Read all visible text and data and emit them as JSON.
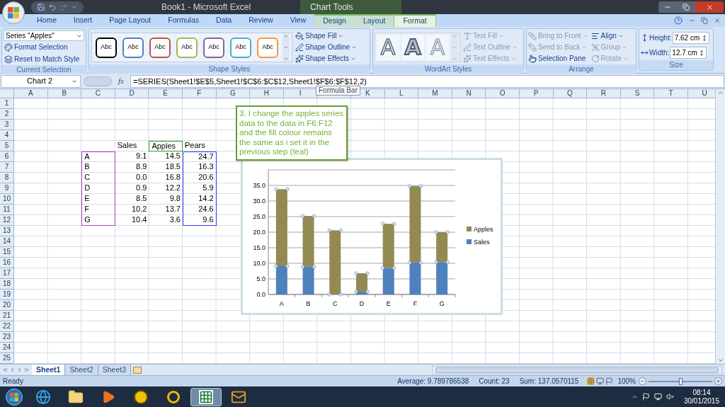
{
  "title_bar": {
    "title": "Book1 - Microsoft Excel",
    "context_group": "Chart Tools"
  },
  "ribbon_tabs": [
    {
      "label": "Home",
      "selected": false,
      "contextual": false
    },
    {
      "label": "Insert",
      "selected": false,
      "contextual": false
    },
    {
      "label": "Page Layout",
      "selected": false,
      "contextual": false
    },
    {
      "label": "Formulas",
      "selected": false,
      "contextual": false
    },
    {
      "label": "Data",
      "selected": false,
      "contextual": false
    },
    {
      "label": "Review",
      "selected": false,
      "contextual": false
    },
    {
      "label": "View",
      "selected": false,
      "contextual": false
    },
    {
      "label": "Design",
      "selected": false,
      "contextual": true
    },
    {
      "label": "Layout",
      "selected": false,
      "contextual": true
    },
    {
      "label": "Format",
      "selected": true,
      "contextual": true
    }
  ],
  "ribbon_groups": [
    {
      "kind": "current_selection",
      "label": "Current Selection",
      "dropdown": "Series \"Apples\"",
      "buttons": [
        {
          "label": "Format Selection",
          "disabled": false,
          "has_menu": false
        },
        {
          "label": "Reset to Match Style",
          "disabled": false,
          "has_menu": false
        }
      ]
    },
    {
      "kind": "shape_styles",
      "label": "Shape Styles",
      "swatches": [
        {
          "text": "Abc",
          "color": "#000000"
        },
        {
          "text": "Abc",
          "color": "#4f81bd"
        },
        {
          "text": "Abc",
          "color": "#c0504d"
        },
        {
          "text": "Abc",
          "color": "#9bbb59"
        },
        {
          "text": "Abc",
          "color": "#8064a2"
        },
        {
          "text": "Abc",
          "color": "#4bacc6"
        },
        {
          "text": "Abc",
          "color": "#f79646"
        }
      ],
      "buttons": [
        {
          "label": "Shape Fill",
          "disabled": false,
          "has_menu": true
        },
        {
          "label": "Shape Outline",
          "disabled": false,
          "has_menu": true
        },
        {
          "label": "Shape Effects",
          "disabled": false,
          "has_menu": true
        }
      ]
    },
    {
      "kind": "wordart",
      "label": "WordArt Styles",
      "samples": [
        {
          "text": "A",
          "kind": "outline"
        },
        {
          "text": "A",
          "kind": "bold"
        },
        {
          "text": "A",
          "kind": "faint"
        }
      ],
      "buttons": [
        {
          "label": "Text Fill",
          "disabled": true,
          "has_menu": true
        },
        {
          "label": "Text Outline",
          "disabled": true,
          "has_menu": true
        },
        {
          "label": "Text Effects",
          "disabled": true,
          "has_menu": true
        }
      ]
    },
    {
      "kind": "arrange",
      "label": "Arrange",
      "buttons": [
        {
          "label": "Bring to Front",
          "disabled": true,
          "has_menu": true
        },
        {
          "label": "Send to Back",
          "disabled": true,
          "has_menu": true
        },
        {
          "label": "Selection Pane",
          "disabled": false,
          "has_menu": false
        },
        {
          "label": "Align",
          "disabled": false,
          "has_menu": true
        },
        {
          "label": "Group",
          "disabled": true,
          "has_menu": true
        },
        {
          "label": "Rotate",
          "disabled": true,
          "has_menu": true
        }
      ]
    },
    {
      "kind": "size",
      "label": "Size",
      "fields": [
        {
          "label": "Height:",
          "value": "7.62 cm"
        },
        {
          "label": "Width:",
          "value": "12.7 cm"
        }
      ]
    }
  ],
  "formula_bar": {
    "name_box": "Chart 2",
    "function_label": "fx",
    "formula": "=SERIES(Sheet1!$E$5,Sheet1!$C$6:$C$12,Sheet1!$F$6:$F$12,2)",
    "tooltip": "Formula Bar"
  },
  "sheet": {
    "columns": [
      "A",
      "B",
      "C",
      "D",
      "E",
      "F",
      "G",
      "H",
      "I",
      null,
      "K",
      "L",
      "M",
      "N",
      "O",
      "P",
      "Q",
      "R",
      "S",
      "T",
      "U"
    ],
    "rows": [
      {
        "label": "1"
      },
      {
        "label": "2"
      },
      {
        "label": "3"
      },
      {
        "label": "4"
      },
      {
        "label": "5",
        "cells": [
          null,
          null,
          null,
          {
            "text": "Sales",
            "kind": "text"
          },
          {
            "text": "Apples",
            "kind": "text",
            "color": "#20a020"
          },
          {
            "text": "Pears",
            "kind": "text"
          }
        ]
      },
      {
        "label": "6",
        "cells": [
          null,
          null,
          {
            "text": "A",
            "kind": "text",
            "color": "#b040d0"
          },
          {
            "text": "9.1",
            "kind": "number"
          },
          {
            "text": "14.5",
            "kind": "number"
          },
          {
            "text": "24.7",
            "kind": "number",
            "color": "#3040f0"
          }
        ]
      },
      {
        "label": "7",
        "cells": [
          null,
          null,
          {
            "text": "B",
            "kind": "text",
            "color": "#b040d0"
          },
          {
            "text": "8.9",
            "kind": "number"
          },
          {
            "text": "18.5",
            "kind": "number"
          },
          {
            "text": "16.3",
            "kind": "number",
            "color": "#3040f0"
          }
        ]
      },
      {
        "label": "8",
        "cells": [
          null,
          null,
          {
            "text": "C",
            "kind": "text",
            "color": "#b040d0"
          },
          {
            "text": "0.0",
            "kind": "number"
          },
          {
            "text": "16.8",
            "kind": "number"
          },
          {
            "text": "20.6",
            "kind": "number",
            "color": "#3040f0"
          }
        ]
      },
      {
        "label": "9",
        "cells": [
          null,
          null,
          {
            "text": "D",
            "kind": "text",
            "color": "#b040d0"
          },
          {
            "text": "0.9",
            "kind": "number"
          },
          {
            "text": "12.2",
            "kind": "number"
          },
          {
            "text": "5.9",
            "kind": "number",
            "color": "#3040f0"
          }
        ]
      },
      {
        "label": "10",
        "cells": [
          null,
          null,
          {
            "text": "E",
            "kind": "text",
            "color": "#b040d0"
          },
          {
            "text": "8.5",
            "kind": "number"
          },
          {
            "text": "9.8",
            "kind": "number"
          },
          {
            "text": "14.2",
            "kind": "number",
            "color": "#3040f0"
          }
        ]
      },
      {
        "label": "11",
        "cells": [
          null,
          null,
          {
            "text": "F",
            "kind": "text",
            "color": "#b040d0"
          },
          {
            "text": "10.2",
            "kind": "number"
          },
          {
            "text": "13.7",
            "kind": "number"
          },
          {
            "text": "24.6",
            "kind": "number",
            "color": "#3040f0"
          }
        ]
      },
      {
        "label": "12",
        "cells": [
          null,
          null,
          {
            "text": "G",
            "kind": "text",
            "color": "#b040d0"
          },
          {
            "text": "10.4",
            "kind": "number"
          },
          {
            "text": "3.6",
            "kind": "number"
          },
          {
            "text": "9.6",
            "kind": "number",
            "color": "#3040f0"
          }
        ]
      },
      {
        "label": "13"
      },
      {
        "label": "14"
      },
      {
        "label": "15"
      },
      {
        "label": "16"
      },
      {
        "label": "17"
      },
      {
        "label": "18"
      },
      {
        "label": "19"
      },
      {
        "label": "20"
      },
      {
        "label": "21"
      },
      {
        "label": "22"
      },
      {
        "label": "23"
      },
      {
        "label": "24"
      },
      {
        "label": "25"
      }
    ]
  },
  "callout": {
    "text": "3. I change the apples series data to the data in F6:F12 and the fill colour remains the same as i set it in the previous step (teal)"
  },
  "chart": {
    "series_selection": [
      {
        "selected": false
      },
      {
        "selected": true
      }
    ],
    "chart_data": {
      "type": "bar",
      "stacked": true,
      "grid": true,
      "legend": true,
      "categories": [
        "A",
        "B",
        "C",
        "D",
        "E",
        "F",
        "G"
      ],
      "series": [
        {
          "name": "Sales",
          "color": "#4f81bd",
          "values": [
            9.1,
            8.9,
            0.0,
            0.9,
            8.5,
            10.2,
            10.4
          ]
        },
        {
          "name": "Apples",
          "color": "#938953",
          "values": [
            24.7,
            16.3,
            20.6,
            5.9,
            14.2,
            24.6,
            9.6
          ]
        }
      ],
      "ylim": [
        0,
        40
      ],
      "yticks": [
        {
          "value": 0,
          "label": "0.0"
        },
        {
          "value": 5,
          "label": "5.0"
        },
        {
          "value": 10,
          "label": "10.0"
        },
        {
          "value": 15,
          "label": "15.0"
        },
        {
          "value": 20,
          "label": "20.0"
        },
        {
          "value": 25,
          "label": "25.0"
        },
        {
          "value": 30,
          "label": "30.0"
        },
        {
          "value": 35,
          "label": "35.0"
        }
      ]
    }
  },
  "sheet_tabs": [
    {
      "label": "Sheet1",
      "selected": true
    },
    {
      "label": "Sheet2",
      "selected": false
    },
    {
      "label": "Sheet3",
      "selected": false
    }
  ],
  "status_bar": {
    "mode": "Ready",
    "stats": [
      "Average: 9.789786538",
      "Count: 23",
      "Sum: 137.0570115"
    ],
    "zoom": "100%",
    "zoom_slider": {
      "level": 0.5
    }
  },
  "taskbar": {
    "apps": [
      {
        "kind": "browser",
        "active": false
      },
      {
        "kind": "folder",
        "active": false
      },
      {
        "kind": "media",
        "active": false
      },
      {
        "kind": "yellow_app",
        "active": false
      },
      {
        "kind": "ring_app",
        "active": false
      },
      {
        "kind": "spreadsheet",
        "active": true
      },
      {
        "kind": "mail",
        "active": false
      }
    ],
    "time": "08:14",
    "date": "30/01/2015"
  }
}
